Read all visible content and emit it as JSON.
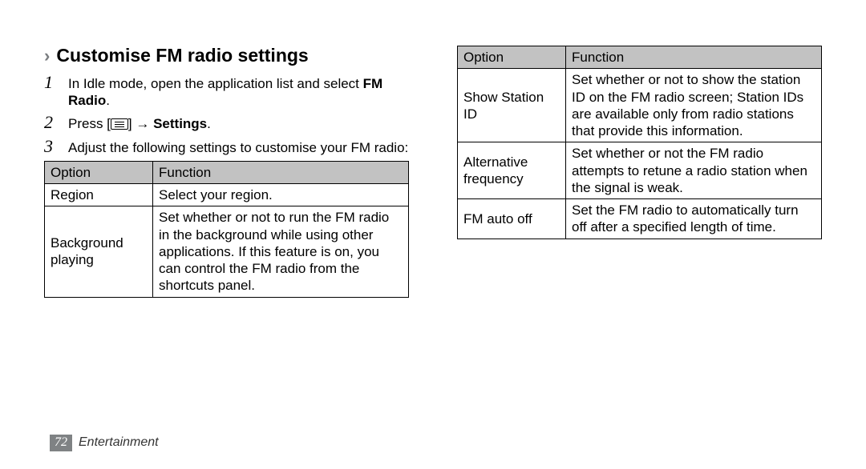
{
  "heading": "Customise FM radio settings",
  "steps": {
    "s1_a": "In Idle mode, open the application list and select ",
    "s1_b": "FM Radio",
    "s1_c": ".",
    "s2_a": "Press [",
    "s2_b": "] → ",
    "s2_c": "Settings",
    "s2_d": ".",
    "s3": "Adjust the following settings to customise your FM radio:"
  },
  "table_headers": {
    "option": "Option",
    "function": "Function"
  },
  "table1": {
    "r1": {
      "opt": "Region",
      "func": "Select your region."
    },
    "r2": {
      "opt": "Background playing",
      "func": "Set whether or not to run the FM radio in the background while using other applications. If this feature is on, you can control the FM radio from the shortcuts panel."
    }
  },
  "table2": {
    "r1": {
      "opt": "Show Station ID",
      "func": "Set whether or not to show the station ID on the FM radio screen; Station IDs are available only from radio stations that provide this information."
    },
    "r2": {
      "opt": "Alternative frequency",
      "func": "Set whether or not the FM radio attempts to retune a radio station when the signal is weak."
    },
    "r3": {
      "opt": "FM auto off",
      "func": "Set the FM radio to automatically turn off after a specified length of time."
    }
  },
  "footer": {
    "page": "72",
    "section": "Entertainment"
  }
}
